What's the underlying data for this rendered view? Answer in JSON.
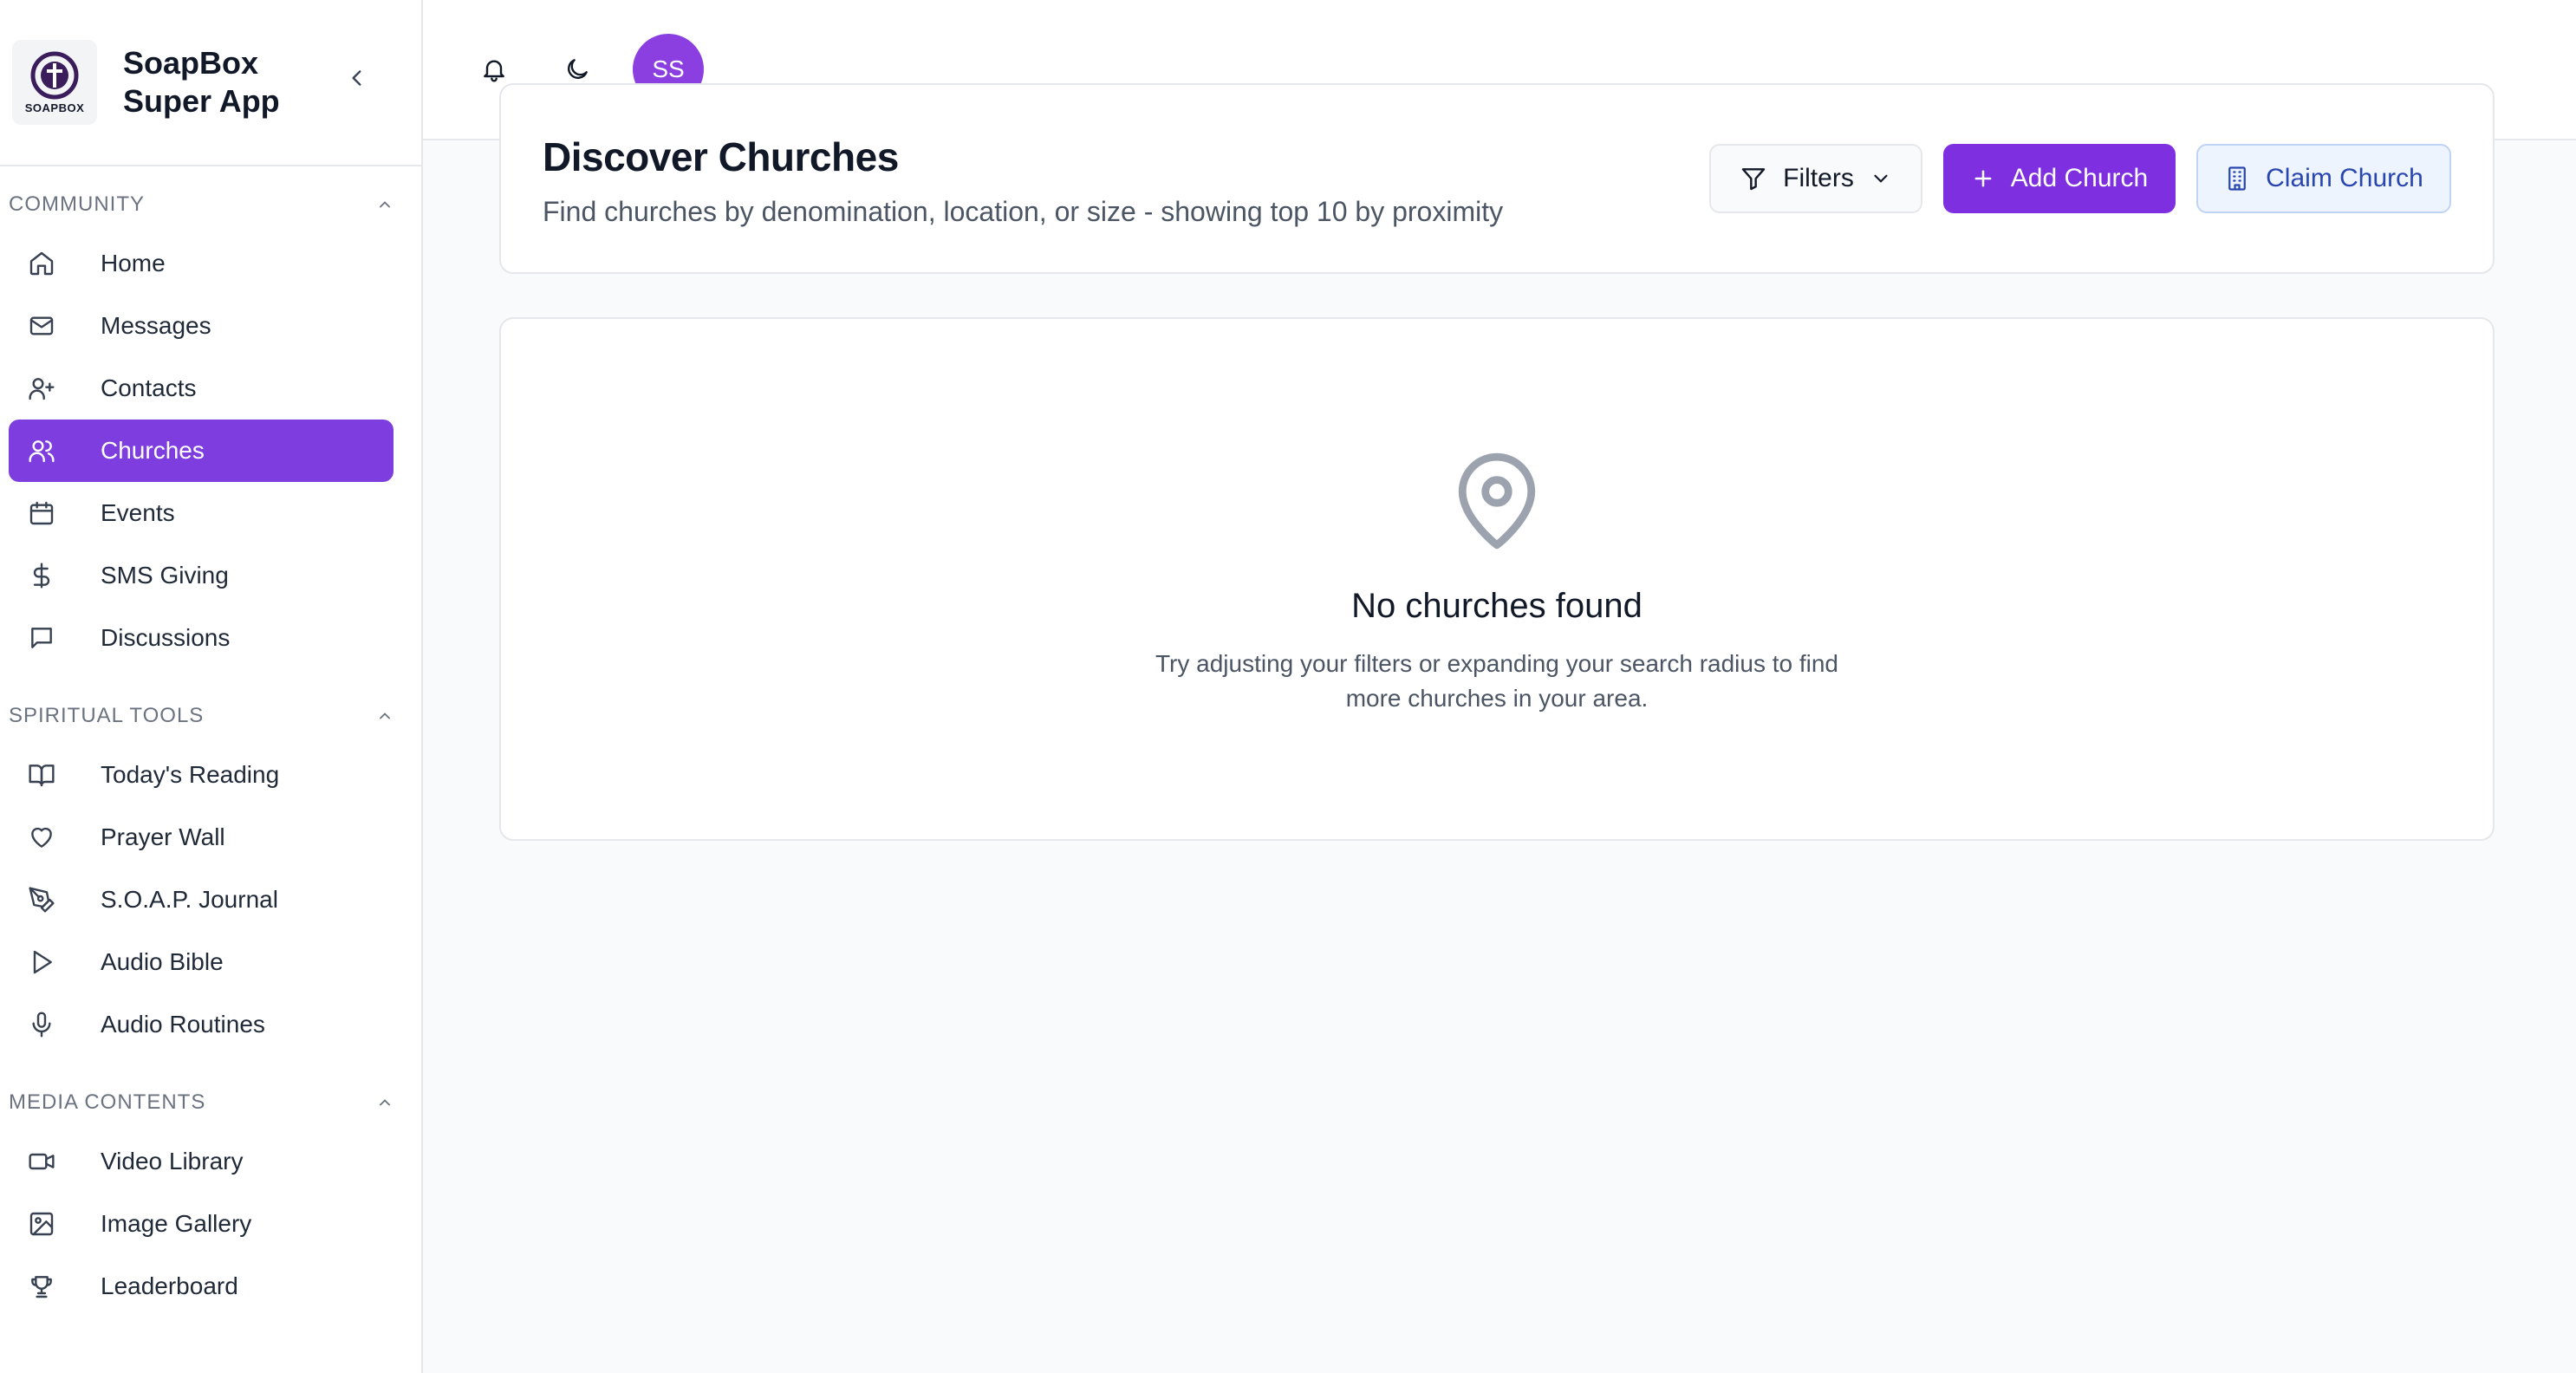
{
  "brand": {
    "name_line1": "SoapBox",
    "name_line2": "Super App",
    "logo_text": "SOAPBOX"
  },
  "sidebar": {
    "sections": [
      {
        "title": "COMMUNITY",
        "items": [
          {
            "label": "Home",
            "icon": "home-icon"
          },
          {
            "label": "Messages",
            "icon": "mail-icon"
          },
          {
            "label": "Contacts",
            "icon": "user-plus-icon"
          },
          {
            "label": "Churches",
            "icon": "users-icon",
            "active": true
          },
          {
            "label": "Events",
            "icon": "calendar-icon"
          },
          {
            "label": "SMS Giving",
            "icon": "dollar-icon"
          },
          {
            "label": "Discussions",
            "icon": "message-square-icon"
          }
        ]
      },
      {
        "title": "SPIRITUAL TOOLS",
        "items": [
          {
            "label": "Today's Reading",
            "icon": "book-open-icon"
          },
          {
            "label": "Prayer Wall",
            "icon": "heart-icon"
          },
          {
            "label": "S.O.A.P. Journal",
            "icon": "pen-tool-icon"
          },
          {
            "label": "Audio Bible",
            "icon": "play-icon"
          },
          {
            "label": "Audio Routines",
            "icon": "mic-icon"
          }
        ]
      },
      {
        "title": "MEDIA CONTENTS",
        "items": [
          {
            "label": "Video Library",
            "icon": "video-icon"
          },
          {
            "label": "Image Gallery",
            "icon": "image-icon"
          },
          {
            "label": "Leaderboard",
            "icon": "trophy-icon"
          }
        ]
      }
    ]
  },
  "topbar": {
    "avatar_initials": "SS"
  },
  "page": {
    "title": "Discover Churches",
    "subtitle": "Find churches by denomination, location, or size - showing top 10 by proximity",
    "filters_label": "Filters",
    "add_label": "Add Church",
    "claim_label": "Claim Church"
  },
  "empty": {
    "title": "No churches found",
    "line1": "Try adjusting your filters or expanding your search radius to find",
    "line2": "more churches in your area."
  },
  "colors": {
    "accent": "#7e3ddf",
    "claim_text": "#2946b0"
  }
}
